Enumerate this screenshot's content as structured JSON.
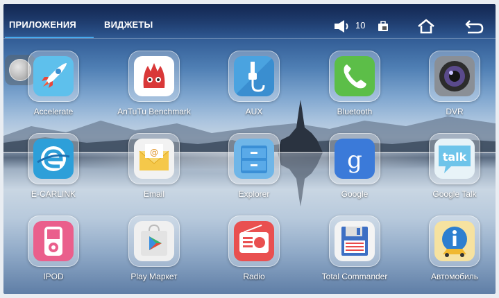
{
  "tabs": [
    {
      "label": "ПРИЛОЖЕНИЯ",
      "active": true
    },
    {
      "label": "ВИДЖЕТЫ",
      "active": false
    }
  ],
  "status": {
    "volume_icon": "speaker-icon",
    "volume_value": "10",
    "other_icon": "bag-icon"
  },
  "nav": {
    "home_icon": "home-icon",
    "back_icon": "back-arrow-icon"
  },
  "apps": [
    {
      "label": "Accelerate",
      "icon": "rocket-icon",
      "color": "#42b3e6"
    },
    {
      "label": "AnTuTu Benchmark",
      "icon": "antutu-icon",
      "color": "#d93838"
    },
    {
      "label": "AUX",
      "icon": "aux-plug-icon",
      "color": "#3f9ad8"
    },
    {
      "label": "Bluetooth",
      "icon": "phone-handset-icon",
      "color": "#55b846"
    },
    {
      "label": "DVR",
      "icon": "camera-lens-icon",
      "color": "#3a3a3a"
    },
    {
      "label": "E-CARLINK",
      "icon": "e-carlink-icon",
      "color": "#2c9ed8"
    },
    {
      "label": "Email",
      "icon": "envelope-icon",
      "color": "#f4c542"
    },
    {
      "label": "Explorer",
      "icon": "file-cabinet-icon",
      "color": "#3a92d6"
    },
    {
      "label": "Google",
      "icon": "google-g-icon",
      "color": "#2f6fcf"
    },
    {
      "label": "Google Talk",
      "icon": "talk-bubble-icon",
      "color": "#6cc0e8"
    },
    {
      "label": "IPOD",
      "icon": "ipod-icon",
      "color": "#e85a8a"
    },
    {
      "label": "Play Маркет",
      "icon": "play-store-icon",
      "color": "#eeeeee"
    },
    {
      "label": "Radio",
      "icon": "radio-icon",
      "color": "#e84848"
    },
    {
      "label": "Total Commander",
      "icon": "floppy-disk-icon",
      "color": "#f2f2f2"
    },
    {
      "label": "Автомобиль",
      "icon": "car-info-icon",
      "color": "#f0cc55"
    }
  ],
  "colors": {
    "accent": "#46a9ee"
  }
}
